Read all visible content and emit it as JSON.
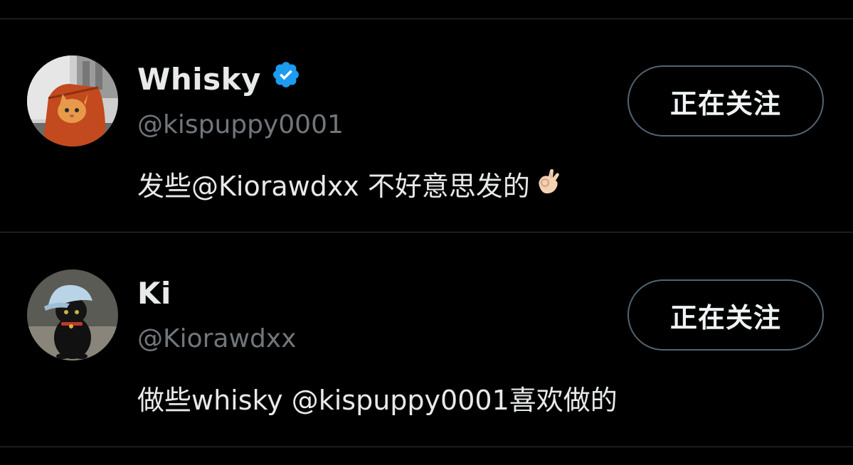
{
  "users": [
    {
      "display_name": "Whisky",
      "verified": true,
      "handle": "@kispuppy0001",
      "bio": "发些@Kiorawdxx 不好意思发的",
      "bio_emoji": "ok-hand-emoji",
      "follow_label": "正在关注",
      "avatar": "orange-kitten-in-bag-avatar"
    },
    {
      "display_name": "Ki",
      "verified": false,
      "handle": "@Kiorawdxx",
      "bio": "做些whisky @kispuppy0001喜欢做的",
      "follow_label": "正在关注",
      "avatar": "black-cat-with-cap-avatar"
    }
  ],
  "colors": {
    "background": "#000000",
    "primary_text": "#e7e9ea",
    "secondary_text": "#71767b",
    "divider": "#2f3336",
    "button_border": "#536471",
    "verified_badge": "#1d9bf0"
  }
}
